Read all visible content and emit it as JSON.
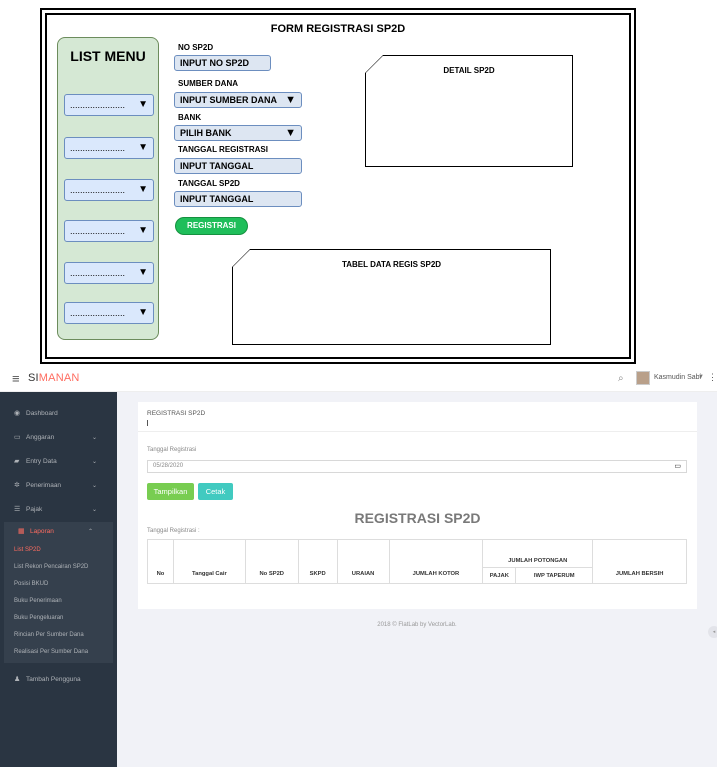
{
  "mockup": {
    "form_title": "FORM REGISTRASI SP2D",
    "list_menu_title": "LIST MENU",
    "menu_placeholder": "......................",
    "menu_arrow": "▼",
    "fields": {
      "no_sp2d_label": "NO SP2D",
      "no_sp2d_input": "INPUT NO SP2D",
      "sumber_dana_label": "SUMBER DANA",
      "sumber_dana_input": "INPUT SUMBER DANA",
      "bank_label": "BANK",
      "bank_input": "PILIH BANK",
      "tanggal_registrasi_label": "TANGGAL REGISTRASI",
      "tanggal_registrasi_input": "INPUT TANGGAL",
      "tanggal_sp2d_label": "TANGGAL SP2D",
      "tanggal_sp2d_input": "INPUT TANGGAL"
    },
    "register_button": "REGISTRASI",
    "detail_box_title": "DETAIL SP2D",
    "table_box_title": "TABEL DATA REGIS SP2D"
  },
  "header": {
    "brand_prefix": "SI",
    "brand_accent": "MANAN",
    "user_name": "Kasmudin Sabi"
  },
  "sidebar": {
    "items": [
      {
        "label": "Dashboard",
        "icon": "dashboard-icon"
      },
      {
        "label": "Anggaran",
        "icon": "laptop-icon"
      },
      {
        "label": "Entry Data",
        "icon": "book-icon"
      },
      {
        "label": "Penerimaan",
        "icon": "cogs-icon"
      },
      {
        "label": "Pajak",
        "icon": "list-icon"
      },
      {
        "label": "Laporan",
        "icon": "table-icon"
      },
      {
        "label": "Tambah Pengguna",
        "icon": "user-icon"
      }
    ],
    "submenu": [
      "List SP2D",
      "List Rekon Pencairan SP2D",
      "Posisi BKUD",
      "Buku Penerimaan",
      "Buku Pengeluaran",
      "Rincian Per Sumber Dana",
      "Realisasi Per Sumber Dana"
    ]
  },
  "panel": {
    "title": "REGISTRASI SP2D",
    "date_label": "Tanggal Registrasi",
    "date_value": "05/28/2020",
    "btn_show": "Tampilkan",
    "btn_print": "Cetak",
    "report_title": "REGISTRASI SP2D",
    "report_sub": "Tanggal Registrasi :",
    "table": {
      "headers": [
        "No",
        "Tanggal Cair",
        "No SP2D",
        "SKPD",
        "URAIAN",
        "JUMLAH KOTOR"
      ],
      "group_header": "JUMLAH POTONGAN",
      "sub_headers": [
        "PAJAK",
        "IWP TAPERUM"
      ],
      "last_header": "JUMLAH BERSIH"
    }
  },
  "footer": "2018 © FlatLab by VectorLab.",
  "colors": {
    "accent": "#ff6c60",
    "sidebar_bg": "#2a3542",
    "btn_green": "#78cd51",
    "btn_teal": "#41cac0",
    "mock_green": "#d5e8d4",
    "mock_blue": "#dae8fc"
  }
}
